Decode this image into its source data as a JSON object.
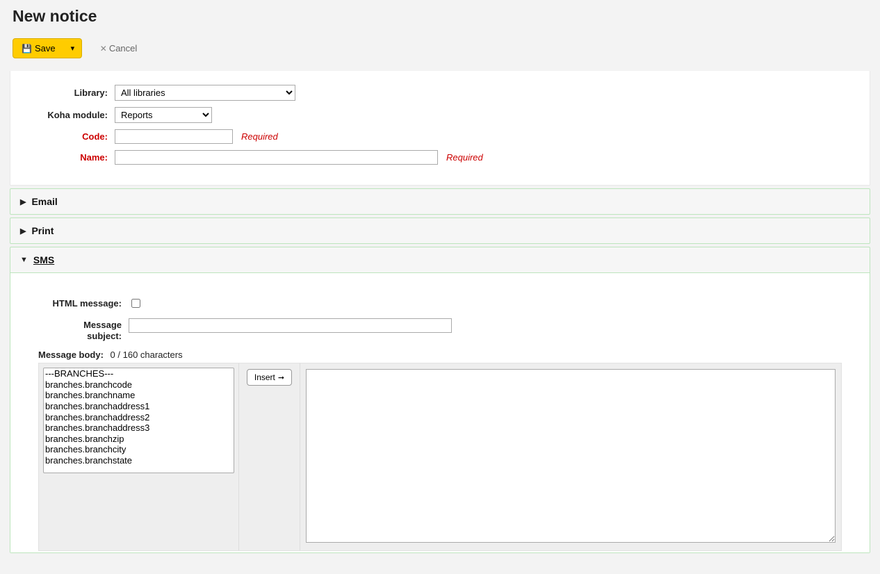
{
  "header": {
    "title": "New notice"
  },
  "toolbar": {
    "save_label": "Save",
    "cancel_label": "Cancel"
  },
  "form": {
    "library": {
      "label": "Library:",
      "selected": "All libraries",
      "options": [
        "All libraries"
      ]
    },
    "module": {
      "label": "Koha module:",
      "selected": "Reports",
      "options": [
        "Reports"
      ]
    },
    "code": {
      "label": "Code:",
      "value": "",
      "required_text": "Required"
    },
    "name": {
      "label": "Name:",
      "value": "",
      "required_text": "Required"
    }
  },
  "sections": {
    "email": {
      "title": "Email",
      "expanded": false
    },
    "print": {
      "title": "Print",
      "expanded": false
    },
    "sms": {
      "title": "SMS",
      "expanded": true
    }
  },
  "sms": {
    "html_label": "HTML message:",
    "html_checked": false,
    "subject_label": "Message subject:",
    "subject_value": "",
    "body_label": "Message body:",
    "char_counter": "0 / 160 characters",
    "insert_label": "Insert",
    "fields": [
      "---BRANCHES---",
      "branches.branchcode",
      "branches.branchname",
      "branches.branchaddress1",
      "branches.branchaddress2",
      "branches.branchaddress3",
      "branches.branchzip",
      "branches.branchcity",
      "branches.branchstate"
    ],
    "body_value": ""
  }
}
